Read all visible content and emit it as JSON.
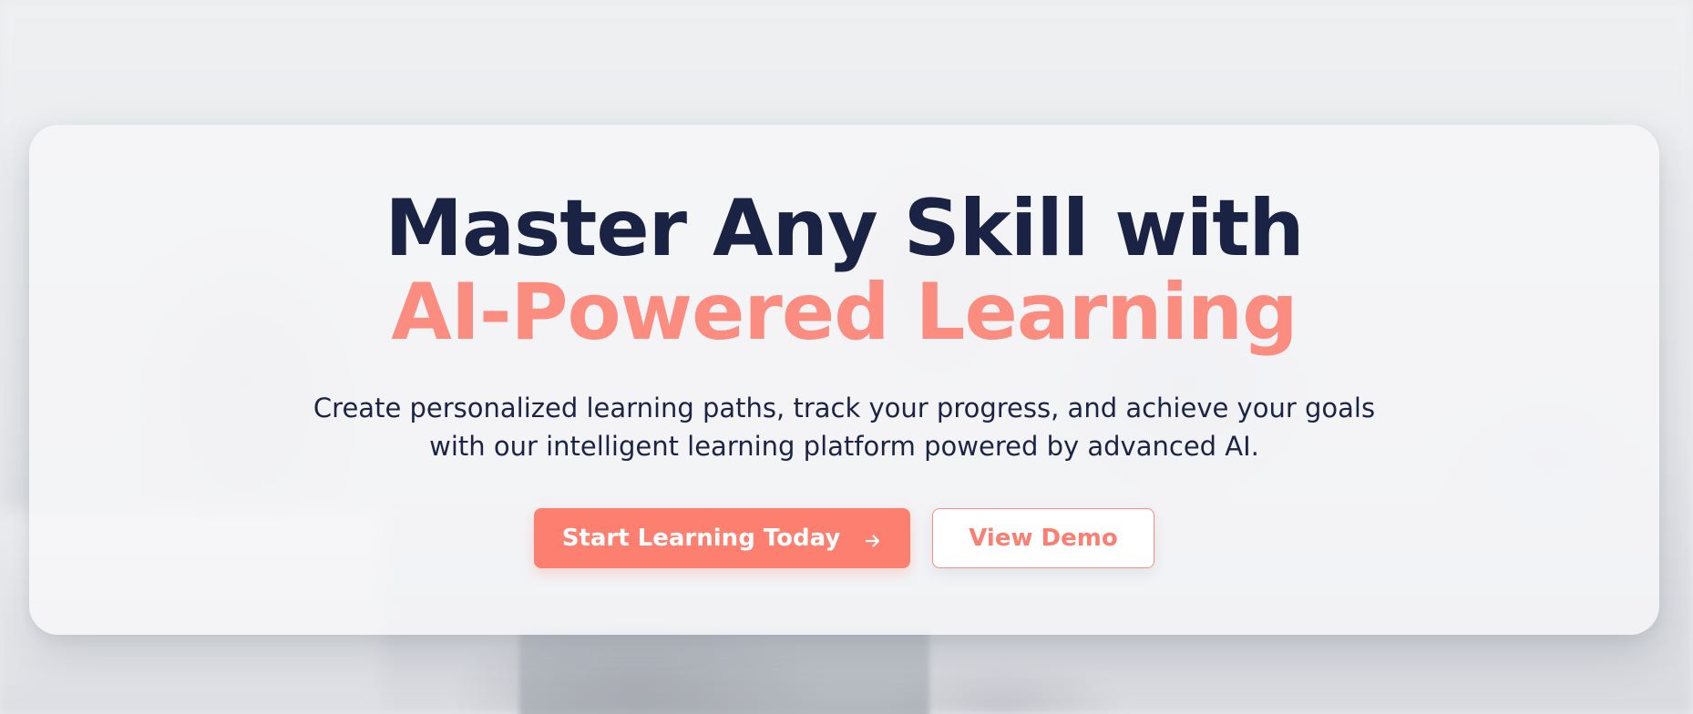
{
  "hero": {
    "headline_line1": "Master Any Skill with",
    "headline_line2": "AI-Powered Learning",
    "subtitle_line1": "Create personalized learning paths, track your progress, and achieve your goals",
    "subtitle_line2": "with our intelligent learning platform powered by advanced AI.",
    "primary_button_label": "Start Learning Today",
    "primary_button_icon": "arrow-right-icon",
    "secondary_button_label": "View Demo"
  },
  "colors": {
    "headline_dark": "#1a2343",
    "accent_coral": "#fd7f70",
    "card_background": "#f6f7f9"
  }
}
